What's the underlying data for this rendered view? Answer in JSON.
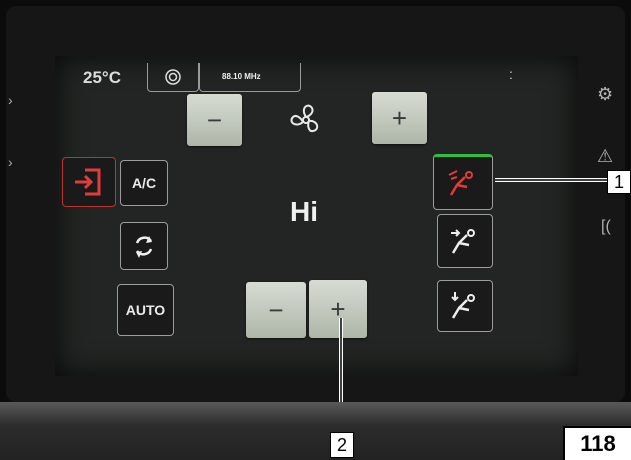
{
  "status": {
    "temperature": "25°C",
    "frequency": "88.10 MHz",
    "menu_dots": ":"
  },
  "controls": {
    "minus": "−",
    "plus": "+",
    "ac_label": "A/C",
    "auto_label": "AUTO",
    "fan_level": "Hi"
  },
  "callouts": {
    "one": "1",
    "two": "2"
  },
  "page_number": "118",
  "icons": {
    "fan": "fan-icon",
    "recirculation": "recirculation-icon",
    "windshield": "windshield-defrost-icon",
    "settings": "gear-icon"
  }
}
